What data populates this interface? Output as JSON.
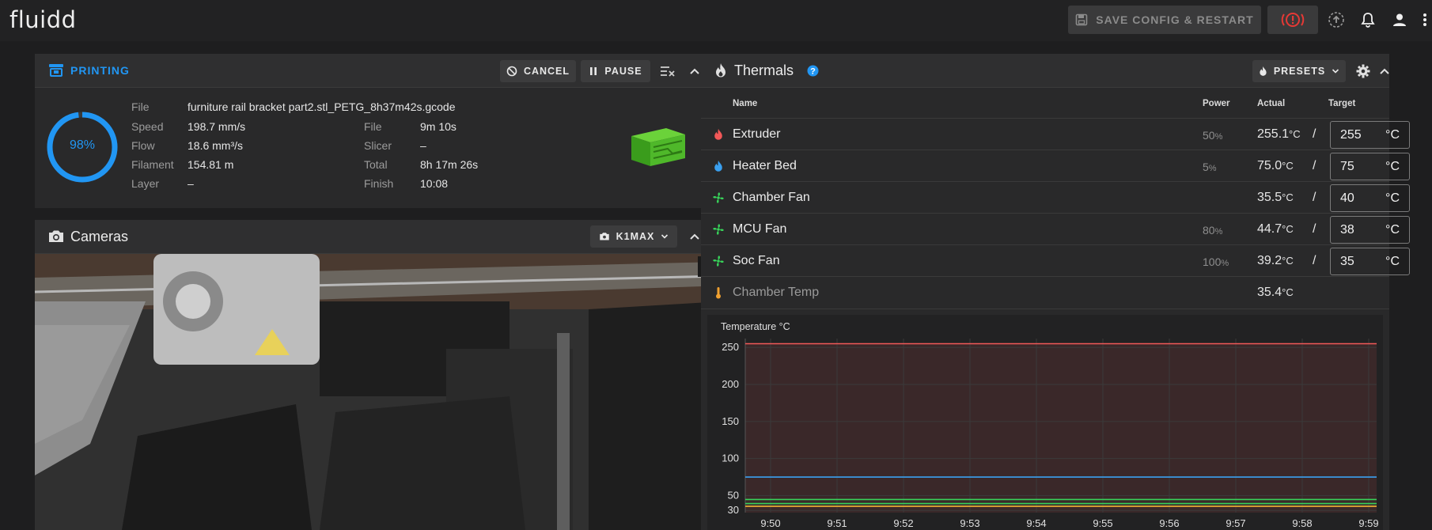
{
  "app": {
    "logo": "fluidd"
  },
  "topbar": {
    "save_config_label": "SAVE CONFIG & RESTART"
  },
  "printing": {
    "title": "PRINTING",
    "cancel_label": "CANCEL",
    "pause_label": "PAUSE",
    "progress_percent": 98,
    "progress_text": "98%",
    "file_label": "File",
    "file_value": "furniture rail bracket part2.stl_PETG_8h37m42s.gcode",
    "left_stats": [
      {
        "label": "Speed",
        "value": "198.7 mm/s"
      },
      {
        "label": "Flow",
        "value": "18.6 mm³/s"
      },
      {
        "label": "Filament",
        "value": "154.81 m"
      },
      {
        "label": "Layer",
        "value": "–"
      }
    ],
    "right_stats": [
      {
        "label": "File",
        "value": "9m 10s"
      },
      {
        "label": "Slicer",
        "value": "–"
      },
      {
        "label": "Total",
        "value": "8h 17m 26s"
      },
      {
        "label": "Finish",
        "value": "10:08"
      }
    ]
  },
  "cameras": {
    "title": "Cameras",
    "camera_select_label": "K1MAX"
  },
  "thermals": {
    "title": "Thermals",
    "presets_label": "PRESETS",
    "headers": {
      "name": "Name",
      "power": "Power",
      "actual": "Actual",
      "target": "Target"
    },
    "rows": [
      {
        "name": "Extruder",
        "power": "50",
        "power_unit": "%",
        "actual": "255.1",
        "unit": "°C",
        "slash": "/",
        "target": "255",
        "target_unit": "°C",
        "icon": "flame-icon",
        "color": "#f25858"
      },
      {
        "name": "Heater Bed",
        "power": "5",
        "power_unit": "%",
        "actual": "75.0",
        "unit": "°C",
        "slash": "/",
        "target": "75",
        "target_unit": "°C",
        "icon": "flame-icon",
        "color": "#3aa0f0"
      },
      {
        "name": "Chamber Fan",
        "power": "",
        "power_unit": "",
        "actual": "35.5",
        "unit": "°C",
        "slash": "/",
        "target": "40",
        "target_unit": "°C",
        "icon": "fan-icon",
        "color": "#38d35a"
      },
      {
        "name": "MCU Fan",
        "power": "80",
        "power_unit": "%",
        "actual": "44.7",
        "unit": "°C",
        "slash": "/",
        "target": "38",
        "target_unit": "°C",
        "icon": "fan-icon",
        "color": "#38d35a"
      },
      {
        "name": "Soc Fan",
        "power": "100",
        "power_unit": "%",
        "actual": "39.2",
        "unit": "°C",
        "slash": "/",
        "target": "35",
        "target_unit": "°C",
        "icon": "fan-icon",
        "color": "#38d35a"
      },
      {
        "name": "Chamber Temp",
        "power": "",
        "power_unit": "",
        "actual": "35.4",
        "unit": "°C",
        "icon": "thermometer-icon",
        "color": "#f0a030"
      }
    ]
  },
  "chart_data": {
    "type": "line",
    "title": "Temperature °C",
    "x": [
      "9:50",
      "9:51",
      "9:52",
      "9:53",
      "9:54",
      "9:55",
      "9:56",
      "9:57",
      "9:58",
      "9:59"
    ],
    "yticks": [
      30,
      50,
      100,
      150,
      200,
      250
    ],
    "ylim": [
      27,
      262
    ],
    "series": [
      {
        "name": "Extruder",
        "values": [
          255.1,
          255.1,
          255.1,
          255.1,
          255.1,
          255.1,
          255.1,
          255.1,
          255.1,
          255.1
        ],
        "color": "#f25858"
      },
      {
        "name": "Heater Bed",
        "values": [
          75,
          75,
          75,
          75,
          75,
          75,
          75,
          75,
          75,
          75
        ],
        "color": "#3aa0f0"
      },
      {
        "name": "MCU Fan",
        "values": [
          44.7,
          44.7,
          44.7,
          44.7,
          44.7,
          44.7,
          44.7,
          44.7,
          44.7,
          44.7
        ],
        "color": "#38d35a"
      },
      {
        "name": "Soc Fan",
        "values": [
          39.2,
          39.2,
          39.2,
          39.2,
          39.2,
          39.2,
          39.2,
          39.2,
          39.2,
          39.2
        ],
        "color": "#38d35a"
      },
      {
        "name": "Chamber Fan",
        "values": [
          35.5,
          35.5,
          35.5,
          35.5,
          35.5,
          35.5,
          35.5,
          35.5,
          35.5,
          35.5
        ],
        "color": "#38d35a"
      },
      {
        "name": "Chamber Temp",
        "values": [
          35.4,
          35.4,
          35.4,
          35.4,
          35.4,
          35.4,
          35.4,
          35.4,
          35.4,
          35.4
        ],
        "color": "#f0a030"
      }
    ]
  }
}
